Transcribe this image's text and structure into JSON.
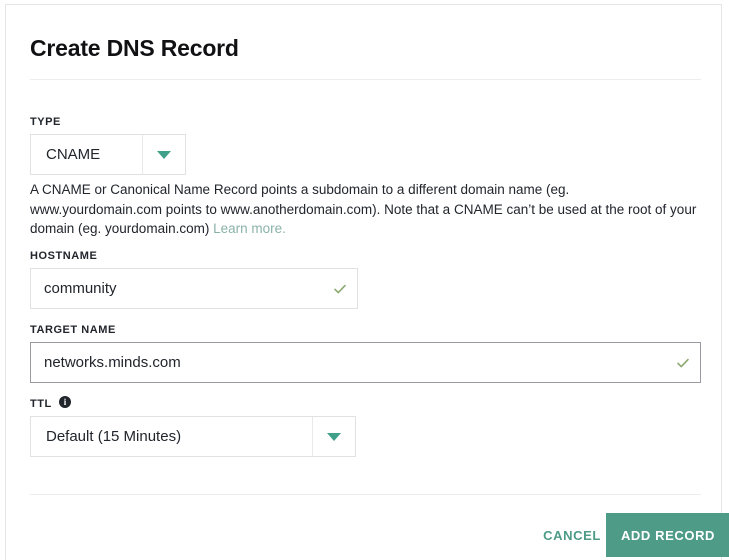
{
  "dialog": {
    "title": "Create DNS Record"
  },
  "fields": {
    "type": {
      "label": "TYPE",
      "value": "CNAME",
      "caret_icon": "chevron-down-icon",
      "description_parts": {
        "body": "A CNAME or Canonical Name Record points a subdomain to a different domain name (eg. www.yourdomain.com points to www.anotherdomain.com). Note that a CNAME can’t be used at the root of your domain (eg. yourdomain.com) ",
        "link": "Learn more."
      }
    },
    "hostname": {
      "label": "HOSTNAME",
      "value": "community",
      "placeholder": "",
      "valid_icon": "check-icon"
    },
    "target_name": {
      "label": "TARGET NAME",
      "value": "networks.minds.com",
      "placeholder": "",
      "valid_icon": "check-icon"
    },
    "ttl": {
      "label": "TTL",
      "info_icon": "info-icon",
      "info_glyph": "i",
      "value": "Default (15 Minutes)",
      "caret_icon": "chevron-down-icon"
    }
  },
  "footer": {
    "cancel_label": "CANCEL",
    "submit_label": "ADD RECORD"
  },
  "colors": {
    "accent": "#4e9b88",
    "caret": "#41a08a",
    "link": "#8ab3a8",
    "check": "#8aa86f",
    "text": "#21252c",
    "border": "#e1e1e3",
    "divider": "#eceded"
  }
}
